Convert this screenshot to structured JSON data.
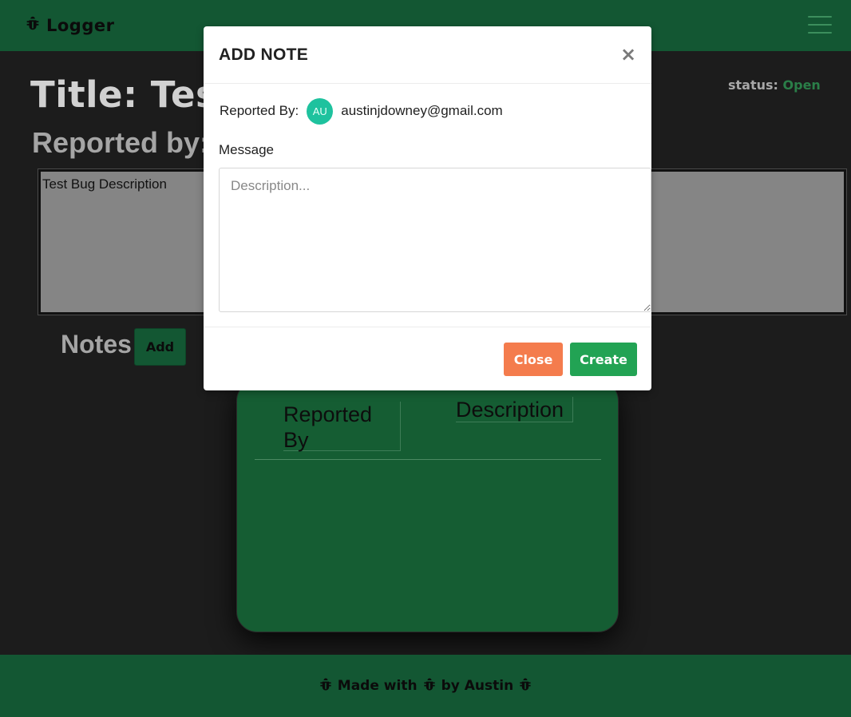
{
  "app": {
    "brand": "Logger",
    "brand_icon": "bug-icon"
  },
  "bug": {
    "title": "Title: Test",
    "status_label": "status:",
    "status_value": "Open",
    "reported_by_label": "Reported by:",
    "description": "Test Bug Description"
  },
  "notes": {
    "heading": "Notes",
    "add_label": "Add",
    "columns": [
      "Reported By",
      "Description"
    ]
  },
  "footer": {
    "text_1": "Made with",
    "text_2": "by Austin"
  },
  "modal": {
    "title": "ADD NOTE",
    "close_symbol": "×",
    "reported_by_label": "Reported By:",
    "avatar_initials": "AU",
    "reporter_email": "austinjdowney@gmail.com",
    "message_label": "Message",
    "message_placeholder": "Description...",
    "message_value": "",
    "close_label": "Close",
    "create_label": "Create"
  },
  "colors": {
    "brand_green": "#135733",
    "status_open": "#2a7e48",
    "avatar": "#1ec29e",
    "close_button": "#f47c4d",
    "create_button": "#22a354"
  }
}
